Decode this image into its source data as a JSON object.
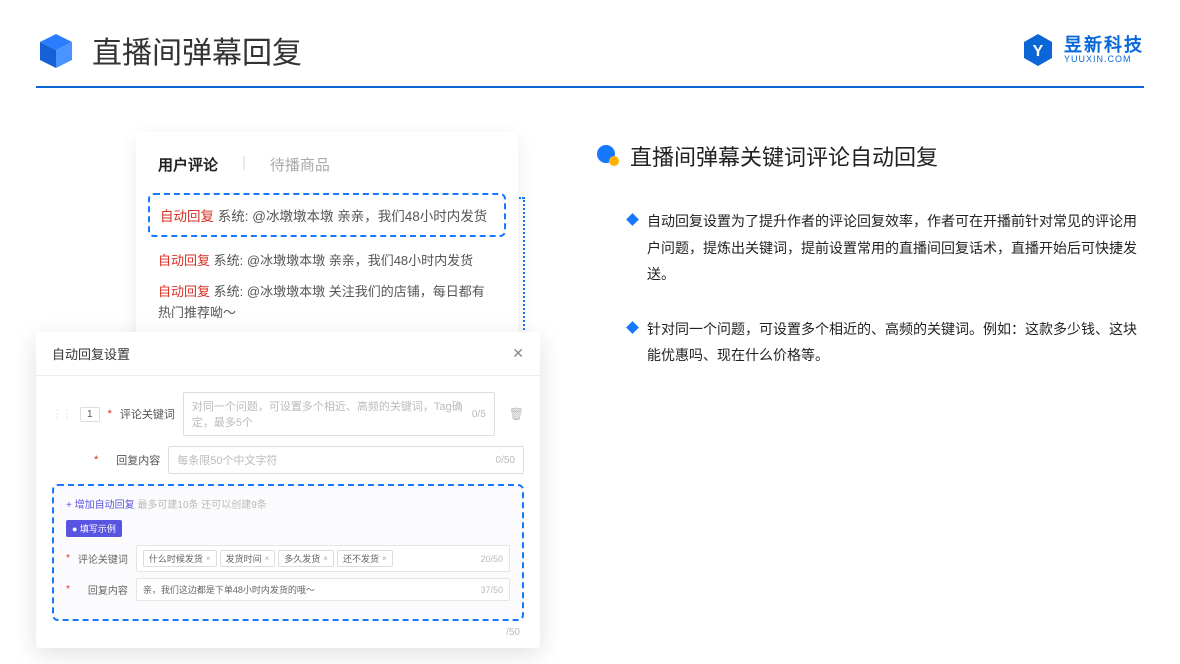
{
  "header": {
    "title": "直播间弹幕回复",
    "brand_name": "昱新科技",
    "brand_url": "YUUXIN.COM"
  },
  "comments": {
    "tab_active": "用户评论",
    "tab_inactive": "待播商品",
    "auto_tag": "自动回复",
    "sys_label": "系统:",
    "row1": "@冰墩墩本墩 亲亲，我们48小时内发货",
    "row2": "@冰墩墩本墩 亲亲，我们48小时内发货",
    "row3": "@冰墩墩本墩 关注我们的店铺，每日都有热门推荐呦～"
  },
  "settings": {
    "title": "自动回复设置",
    "row_num": "1",
    "kw_label": "评论关键词",
    "kw_placeholder": "对同一个问题，可设置多个相近、高频的关键词，Tag确定，最多5个",
    "kw_count": "0/5",
    "reply_label": "回复内容",
    "reply_placeholder": "每条限50个中文字符",
    "reply_count": "0/50",
    "add_link": "+ 增加自动回复",
    "add_note": "最多可建10条 还可以创建9条",
    "example_badge": "● 填写示例",
    "ex_kw_label": "评论关键词",
    "ex_tags": [
      "什么时候发货",
      "发货时间",
      "多久发货",
      "还不发货"
    ],
    "ex_kw_count": "20/50",
    "ex_reply_label": "回复内容",
    "ex_reply_text": "亲，我们这边都是下单48小时内发货的哦～",
    "ex_reply_count": "37/50",
    "bottom_count": "/50"
  },
  "right": {
    "section_title": "直播间弹幕关键词评论自动回复",
    "bullet1": "自动回复设置为了提升作者的评论回复效率，作者可在开播前针对常见的评论用户问题，提炼出关键词，提前设置常用的直播间回复话术，直播开始后可快捷发送。",
    "bullet2": "针对同一个问题，可设置多个相近的、高频的关键词。例如：这款多少钱、这块能优惠吗、现在什么价格等。"
  }
}
